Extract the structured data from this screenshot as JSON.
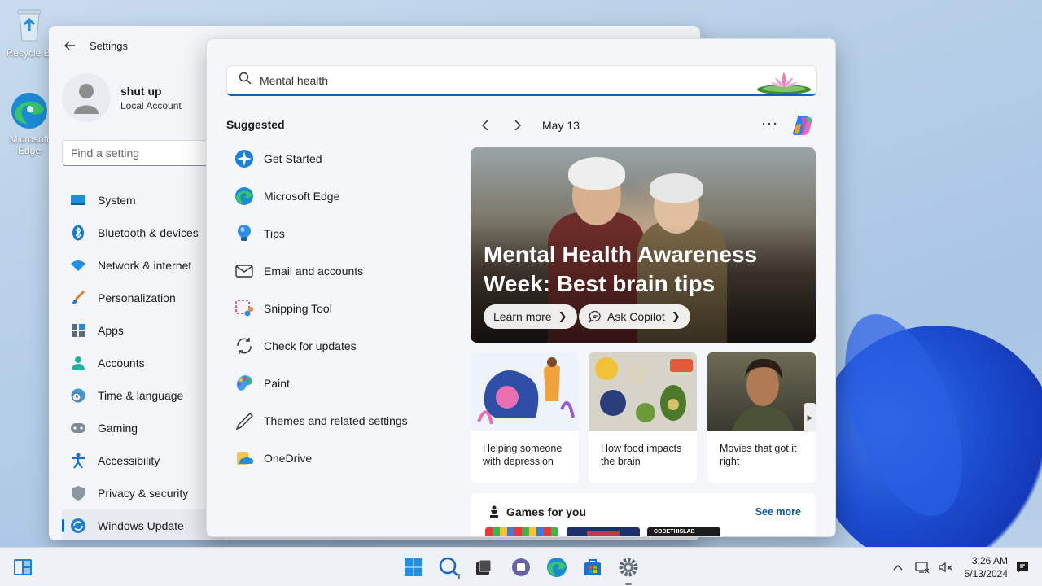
{
  "desktop": {
    "icons": [
      {
        "label": "Recycle Bin",
        "label_visible": "Recycle Bi"
      },
      {
        "label_line1": "Microsoft",
        "label_line2": "Edge"
      }
    ]
  },
  "settings": {
    "title": "Settings",
    "user": {
      "name": "shut up",
      "account": "Local Account"
    },
    "find_placeholder": "Find a setting",
    "nav": [
      {
        "label": "System",
        "icon": "monitor-icon"
      },
      {
        "label": "Bluetooth & devices",
        "icon": "bluetooth-icon"
      },
      {
        "label": "Network & internet",
        "icon": "wifi-icon"
      },
      {
        "label": "Personalization",
        "icon": "brush-icon"
      },
      {
        "label": "Apps",
        "icon": "apps-icon"
      },
      {
        "label": "Accounts",
        "icon": "person-icon"
      },
      {
        "label": "Time & language",
        "icon": "clock-globe-icon"
      },
      {
        "label": "Gaming",
        "icon": "gamepad-icon"
      },
      {
        "label": "Accessibility",
        "icon": "accessibility-icon"
      },
      {
        "label": "Privacy & security",
        "icon": "shield-icon"
      },
      {
        "label": "Windows Update",
        "icon": "update-icon",
        "active": true
      }
    ]
  },
  "search": {
    "query": "Mental health",
    "suggested_title": "Suggested",
    "suggestions": [
      {
        "label": "Get Started",
        "icon": "get-started-icon"
      },
      {
        "label": "Microsoft Edge",
        "icon": "edge-icon"
      },
      {
        "label": "Tips",
        "icon": "tips-icon"
      },
      {
        "label": "Email and accounts",
        "icon": "mail-icon"
      },
      {
        "label": "Snipping Tool",
        "icon": "snipping-tool-icon"
      },
      {
        "label": "Check for updates",
        "icon": "refresh-icon"
      },
      {
        "label": "Paint",
        "icon": "paint-icon"
      },
      {
        "label": "Themes and related settings",
        "icon": "pen-icon"
      },
      {
        "label": "OneDrive",
        "icon": "onedrive-icon"
      }
    ],
    "date": "May 13",
    "more": "···",
    "hero": {
      "title": "Mental Health Awareness Week: Best brain tips",
      "learn_more": "Learn more",
      "ask_copilot": "Ask Copilot"
    },
    "cards": [
      {
        "caption": "Helping someone with depression"
      },
      {
        "caption": "How food impacts the brain"
      },
      {
        "caption": "Movies that got it right"
      }
    ],
    "games": {
      "title": "Games for you",
      "see_more": "See more",
      "thumb_text": "CODETHISLAB"
    }
  },
  "taskbar": {
    "time": "3:26 AM",
    "date": "5/13/2024",
    "icons": [
      "widgets-icon",
      "start-icon",
      "search-icon",
      "task-view-icon",
      "teams-icon",
      "edge-icon",
      "store-icon",
      "settings-icon"
    ]
  },
  "colors": {
    "accent": "#0067c0",
    "link": "#0b57a6",
    "flyout_bg": "#f4f6f9"
  }
}
